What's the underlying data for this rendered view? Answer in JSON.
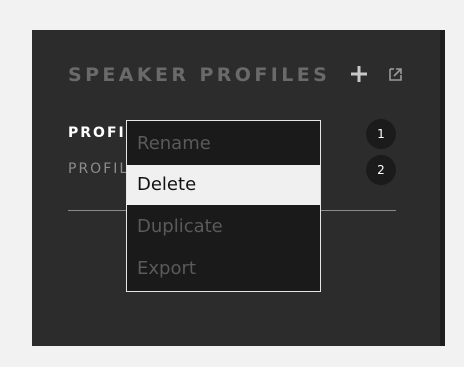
{
  "panel": {
    "title": "SPEAKER PROFILES",
    "add_icon": "plus-icon",
    "export_icon": "export-icon"
  },
  "profiles": [
    {
      "label": "PROFILE 1",
      "badge": "1",
      "active": true
    },
    {
      "label": "PROFILE 2",
      "badge": "2",
      "active": false
    }
  ],
  "context_menu": {
    "items": [
      {
        "label": "Rename",
        "state": "disabled"
      },
      {
        "label": "Delete",
        "state": "highlighted"
      },
      {
        "label": "Duplicate",
        "state": "disabled"
      },
      {
        "label": "Export",
        "state": "disabled"
      }
    ]
  },
  "colors": {
    "background": "#2c2c2c",
    "title": "#6a6a6a",
    "highlight": "#f0f0f0",
    "disabled_text": "#5a5a5a"
  }
}
